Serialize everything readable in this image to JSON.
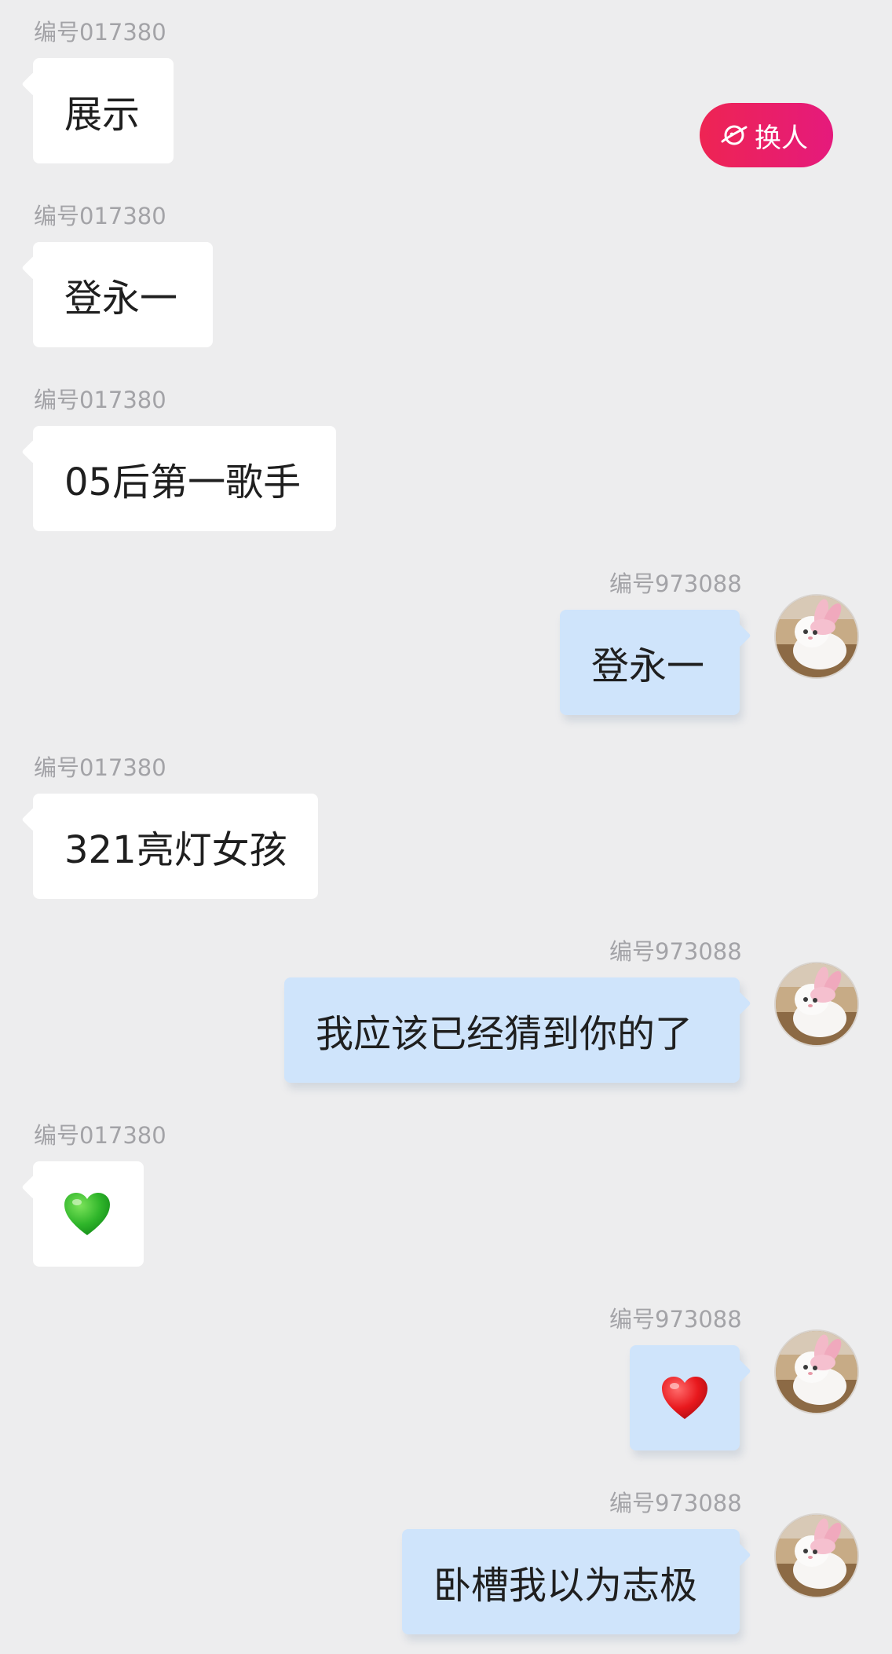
{
  "switch_button": {
    "label": "换人",
    "icon": "planet-icon",
    "colors": [
      "#ee2453",
      "#e51a7c"
    ]
  },
  "colors": {
    "background": "#ededee",
    "incoming_bubble": "#ffffff",
    "outgoing_bubble": "#cfe4fb",
    "sender_label": "#a3a3a7"
  },
  "messages": [
    {
      "sender": "编号017380",
      "text": "展示",
      "direction": "incoming"
    },
    {
      "sender": "编号017380",
      "text": "登永一",
      "direction": "incoming"
    },
    {
      "sender": "编号017380",
      "text": "05后第一歌手",
      "direction": "incoming"
    },
    {
      "sender": "编号973088",
      "text": "登永一",
      "direction": "outgoing",
      "avatar": "cat-avatar"
    },
    {
      "sender": "编号017380",
      "text": "321亮灯女孩",
      "direction": "incoming"
    },
    {
      "sender": "编号973088",
      "text": "我应该已经猜到你的了",
      "direction": "outgoing",
      "avatar": "cat-avatar"
    },
    {
      "sender": "编号017380",
      "text": "",
      "emoji": "green-heart-icon",
      "direction": "incoming"
    },
    {
      "sender": "编号973088",
      "text": "",
      "emoji": "red-heart-icon",
      "direction": "outgoing",
      "avatar": "cat-avatar"
    },
    {
      "sender": "编号973088",
      "text": "卧槽我以为志极",
      "direction": "outgoing",
      "avatar": "cat-avatar"
    }
  ]
}
